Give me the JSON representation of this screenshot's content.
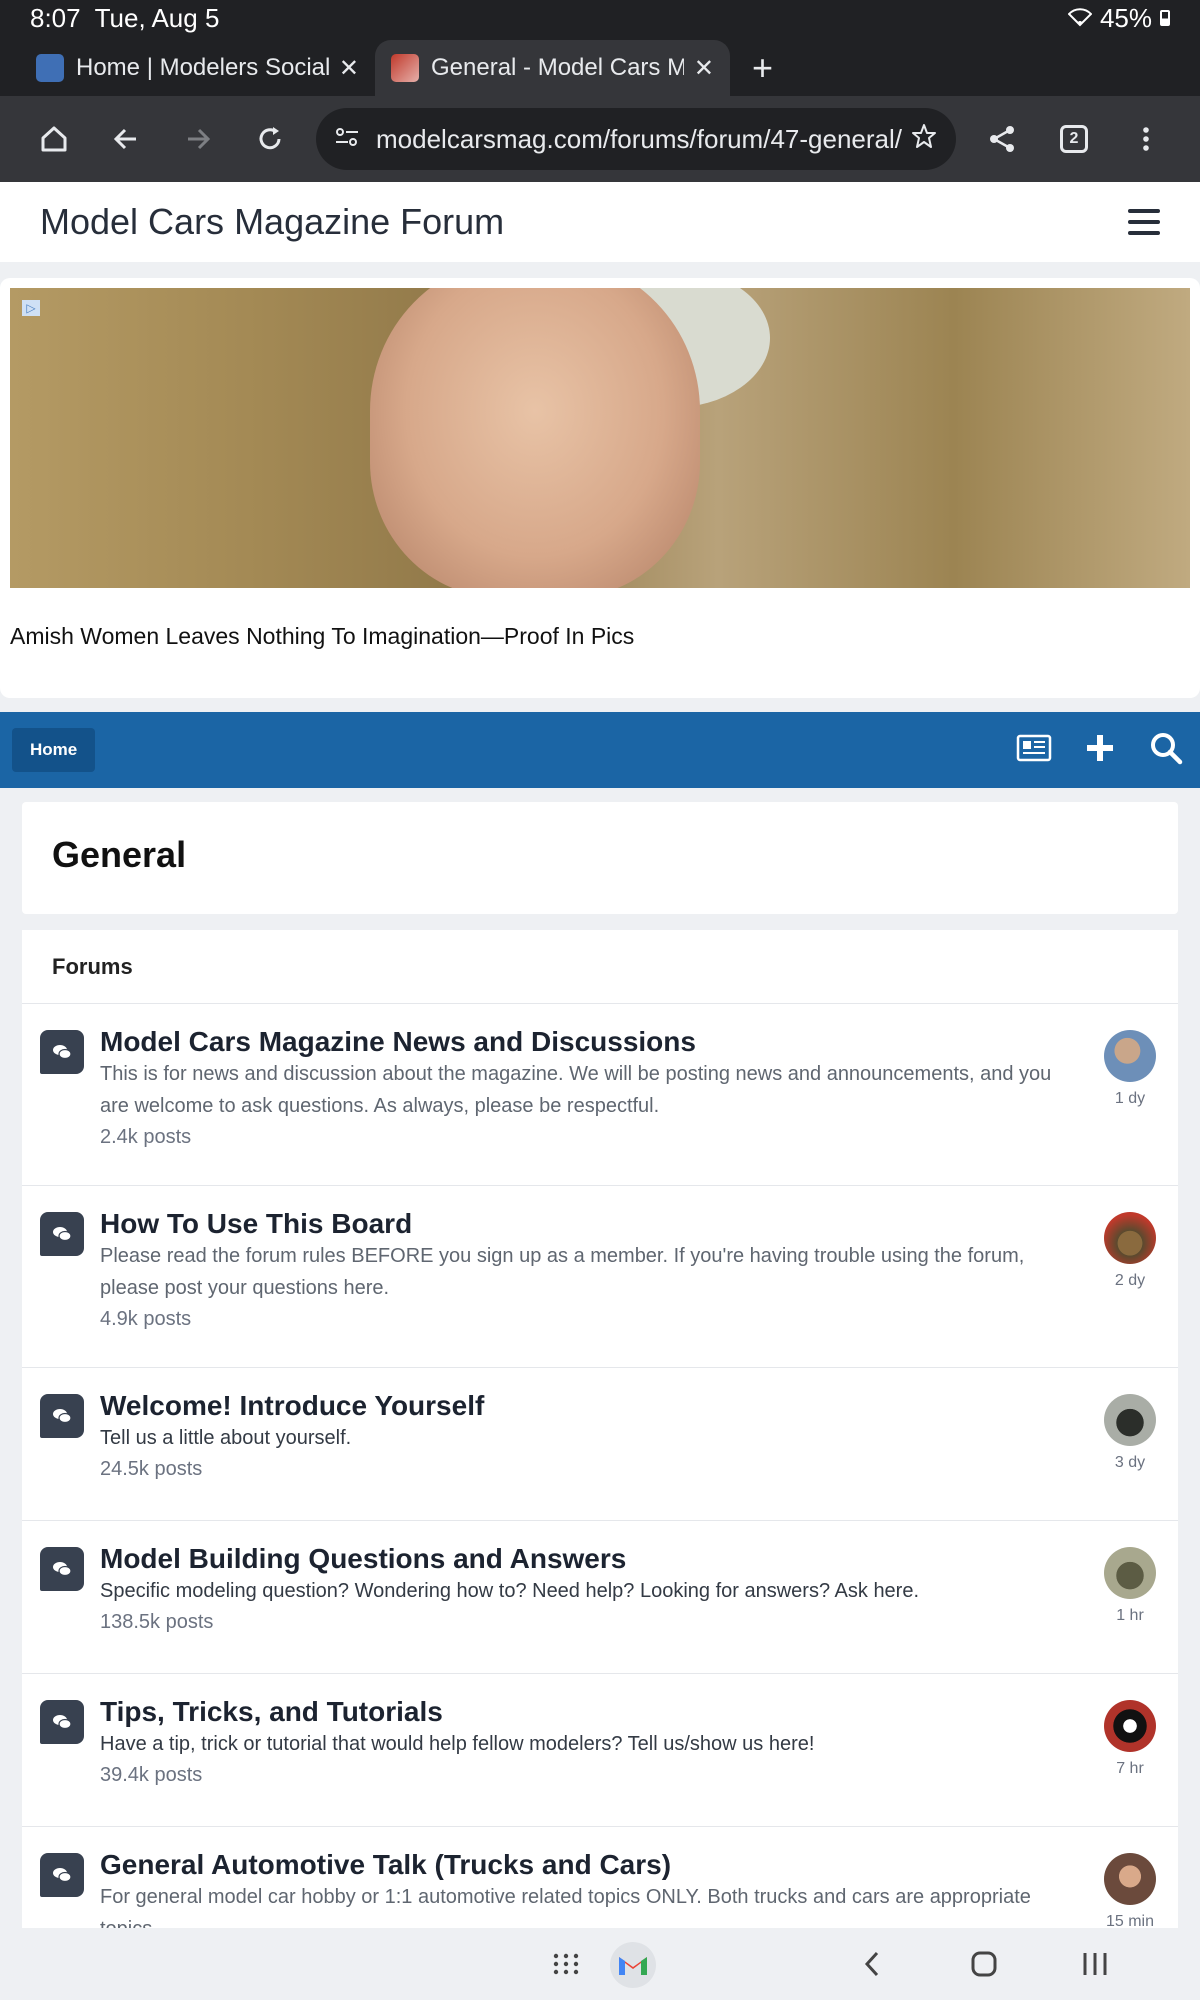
{
  "status_bar": {
    "time": "8:07",
    "date": "Tue, Aug 5",
    "battery": "45%"
  },
  "browser": {
    "tabs": [
      {
        "title": "Home | Modelers Social C",
        "active": false
      },
      {
        "title": "General - Model Cars Ma",
        "active": true
      }
    ],
    "url": "modelcarsmag.com/forums/forum/47-general/",
    "tab_count": "2"
  },
  "site": {
    "brand": "Model Cars Magazine Forum"
  },
  "ad": {
    "caption": "Amish Women Leaves Nothing To Imagination—Proof In Pics"
  },
  "nav": {
    "home_label": "Home"
  },
  "page": {
    "title": "General",
    "section_heading": "Forums"
  },
  "forums": [
    {
      "name": "Model Cars Magazine News and Discussions",
      "description": "This is for news and discussion about the magazine. We will be posting news and announcements, and you are welcome to ask questions. As always, please be respectful.",
      "posts": "2.4k posts",
      "last_activity": "1 dy",
      "avatar_color": "#6d8fb8"
    },
    {
      "name": "How To Use This Board",
      "description": "Please read the forum rules BEFORE you sign up as a member. If you're having trouble using the forum, please post your questions here.",
      "posts": "4.9k posts",
      "last_activity": "2 dy",
      "avatar_color": "#5a4a2e"
    },
    {
      "name": "Welcome! Introduce Yourself",
      "description": "Tell us a little about yourself.",
      "posts": "24.5k posts",
      "last_activity": "3 dy",
      "avatar_color": "#4b4f48"
    },
    {
      "name": "Model Building Questions and Answers",
      "description": "Specific modeling question? Wondering how to? Need help? Looking for answers? Ask here.",
      "posts": "138.5k posts",
      "last_activity": "1 hr",
      "avatar_color": "#7a7a5e"
    },
    {
      "name": "Tips, Tricks, and Tutorials",
      "description": "Have a tip, trick or tutorial that would help fellow modelers? Tell us/show us here!",
      "posts": "39.4k posts",
      "last_activity": "7 hr",
      "avatar_color": "#b0332a"
    },
    {
      "name": "General Automotive Talk (Trucks and Cars)",
      "description": "For general model car hobby or 1:1 automotive related topics ONLY. Both trucks and cars are appropriate topics.",
      "posts": "",
      "last_activity": "15 min",
      "avatar_color": "#6b4a3c"
    }
  ]
}
